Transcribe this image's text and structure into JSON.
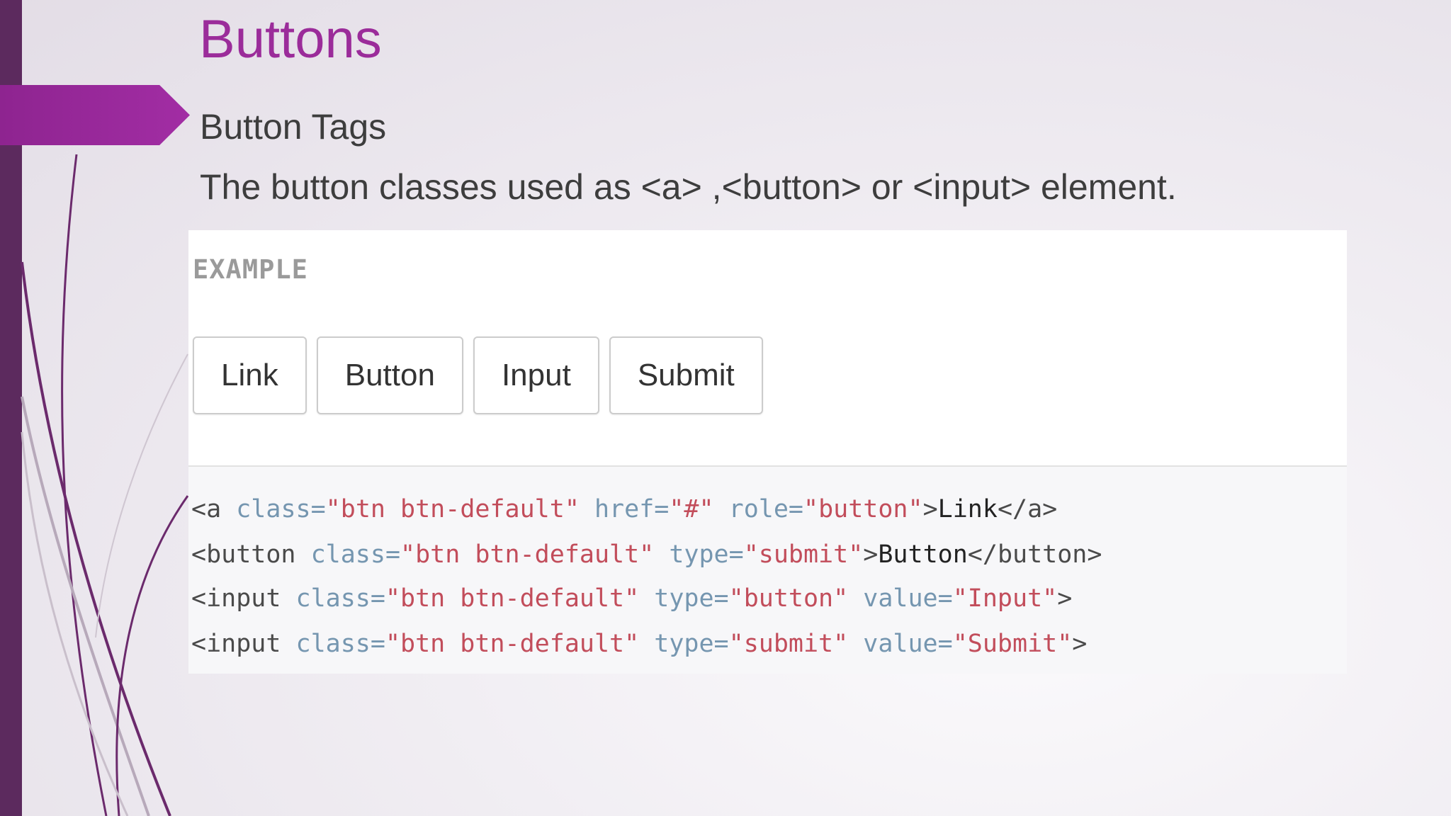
{
  "slide": {
    "title": "Buttons",
    "bullet_1": "Button Tags",
    "bullet_2": "The button classes used as <a> ,<button> or <input> element."
  },
  "example": {
    "label": "EXAMPLE",
    "buttons": [
      "Link",
      "Button",
      "Input",
      "Submit"
    ]
  },
  "code": {
    "line1": {
      "open": "<a",
      "a1": " class=",
      "v1": "\"btn btn-default\"",
      "a2": " href=",
      "v2": "\"#\"",
      "a3": " role=",
      "v3": "\"button\"",
      "close": ">",
      "text": "Link",
      "end": "</a>"
    },
    "line2": {
      "open": "<button",
      "a1": " class=",
      "v1": "\"btn btn-default\"",
      "a2": " type=",
      "v2": "\"submit\"",
      "close": ">",
      "text": "Button",
      "end": "</button>"
    },
    "line3": {
      "open": "<input",
      "a1": " class=",
      "v1": "\"btn btn-default\"",
      "a2": " type=",
      "v2": "\"button\"",
      "a3": " value=",
      "v3": "\"Input\"",
      "close": ">"
    },
    "line4": {
      "open": "<input",
      "a1": " class=",
      "v1": "\"btn btn-default\"",
      "a2": " type=",
      "v2": "\"submit\"",
      "a3": " value=",
      "v3": "\"Submit\"",
      "close": ">"
    }
  },
  "colors": {
    "title_purple": "#9b2c9a",
    "accent_purple": "#a22da4",
    "dark_bar": "#5c2a5e",
    "code_tag": "#4a4a4a",
    "code_attr": "#7596b0",
    "code_value": "#c24d5b"
  }
}
